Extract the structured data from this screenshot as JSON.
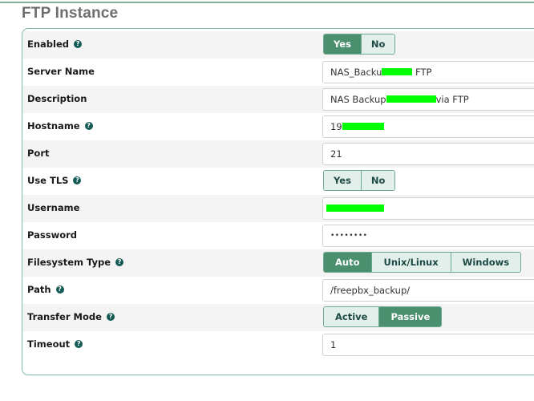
{
  "page": {
    "title": "FTP Instance"
  },
  "colors": {
    "accent": "#4a8f6e",
    "accent_border": "#82b9a0",
    "help_icon": "#145a55",
    "redaction": "#00ff00"
  },
  "form": {
    "enabled": {
      "label": "Enabled",
      "help": true,
      "options": [
        "Yes",
        "No"
      ],
      "selected": "Yes"
    },
    "server_name": {
      "label": "Server Name",
      "value_prefix": "NAS_Backu",
      "value_suffix": "FTP",
      "redacted": true
    },
    "description": {
      "label": "Description",
      "value_prefix": "NAS Backup",
      "value_suffix": "via FTP",
      "redacted": true
    },
    "hostname": {
      "label": "Hostname",
      "help": true,
      "value_prefix": "19",
      "value_suffix": "",
      "redacted": true
    },
    "port": {
      "label": "Port",
      "value": "21"
    },
    "use_tls": {
      "label": "Use TLS",
      "help": true,
      "options": [
        "Yes",
        "No"
      ],
      "selected": ""
    },
    "username": {
      "label": "Username",
      "value_prefix": "",
      "redacted": true
    },
    "password": {
      "label": "Password",
      "value": "••••••••"
    },
    "filesystem_type": {
      "label": "Filesystem Type",
      "help": true,
      "options": [
        "Auto",
        "Unix/Linux",
        "Windows"
      ],
      "selected": "Auto"
    },
    "path": {
      "label": "Path",
      "help": true,
      "value": "/freepbx_backup/"
    },
    "transfer_mode": {
      "label": "Transfer Mode",
      "help": true,
      "options": [
        "Active",
        "Passive"
      ],
      "selected": "Passive"
    },
    "timeout": {
      "label": "Timeout",
      "help": true,
      "value": "1"
    }
  },
  "icons": {
    "help": "question-circle-icon"
  }
}
